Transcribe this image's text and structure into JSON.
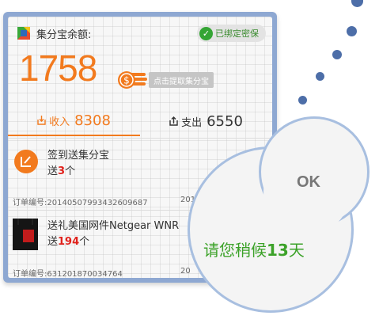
{
  "header": {
    "title": "集分宝余额:",
    "bound_badge": "已绑定密保"
  },
  "balance": {
    "amount": "1758",
    "withdraw_tip": "点击提取集分宝"
  },
  "tabs": [
    {
      "label": "收入",
      "value": "8308"
    },
    {
      "label": "支出",
      "value": "6550"
    }
  ],
  "records": [
    {
      "title": "签到送集分宝",
      "sub_prefix": "送",
      "sub_count": "3",
      "sub_suffix": "个",
      "order": "订单编号:20140507993432609687",
      "date_fragment": "2014",
      "stamp_fragment": "0"
    },
    {
      "title": "送礼美国网件Netgear WNR",
      "sub_prefix": "送",
      "sub_count": "194",
      "sub_suffix": "个",
      "order": "订单编号:631201870034764",
      "date_fragment": "20"
    }
  ],
  "bubbles": {
    "ok": "OK",
    "wait_prefix": "请您稍候",
    "wait_days": "13",
    "wait_suffix": "天"
  },
  "colors": {
    "accent": "#f27a1e",
    "highlight": "#e0211b",
    "success": "#3ca229",
    "frame": "#8ea8d2"
  }
}
